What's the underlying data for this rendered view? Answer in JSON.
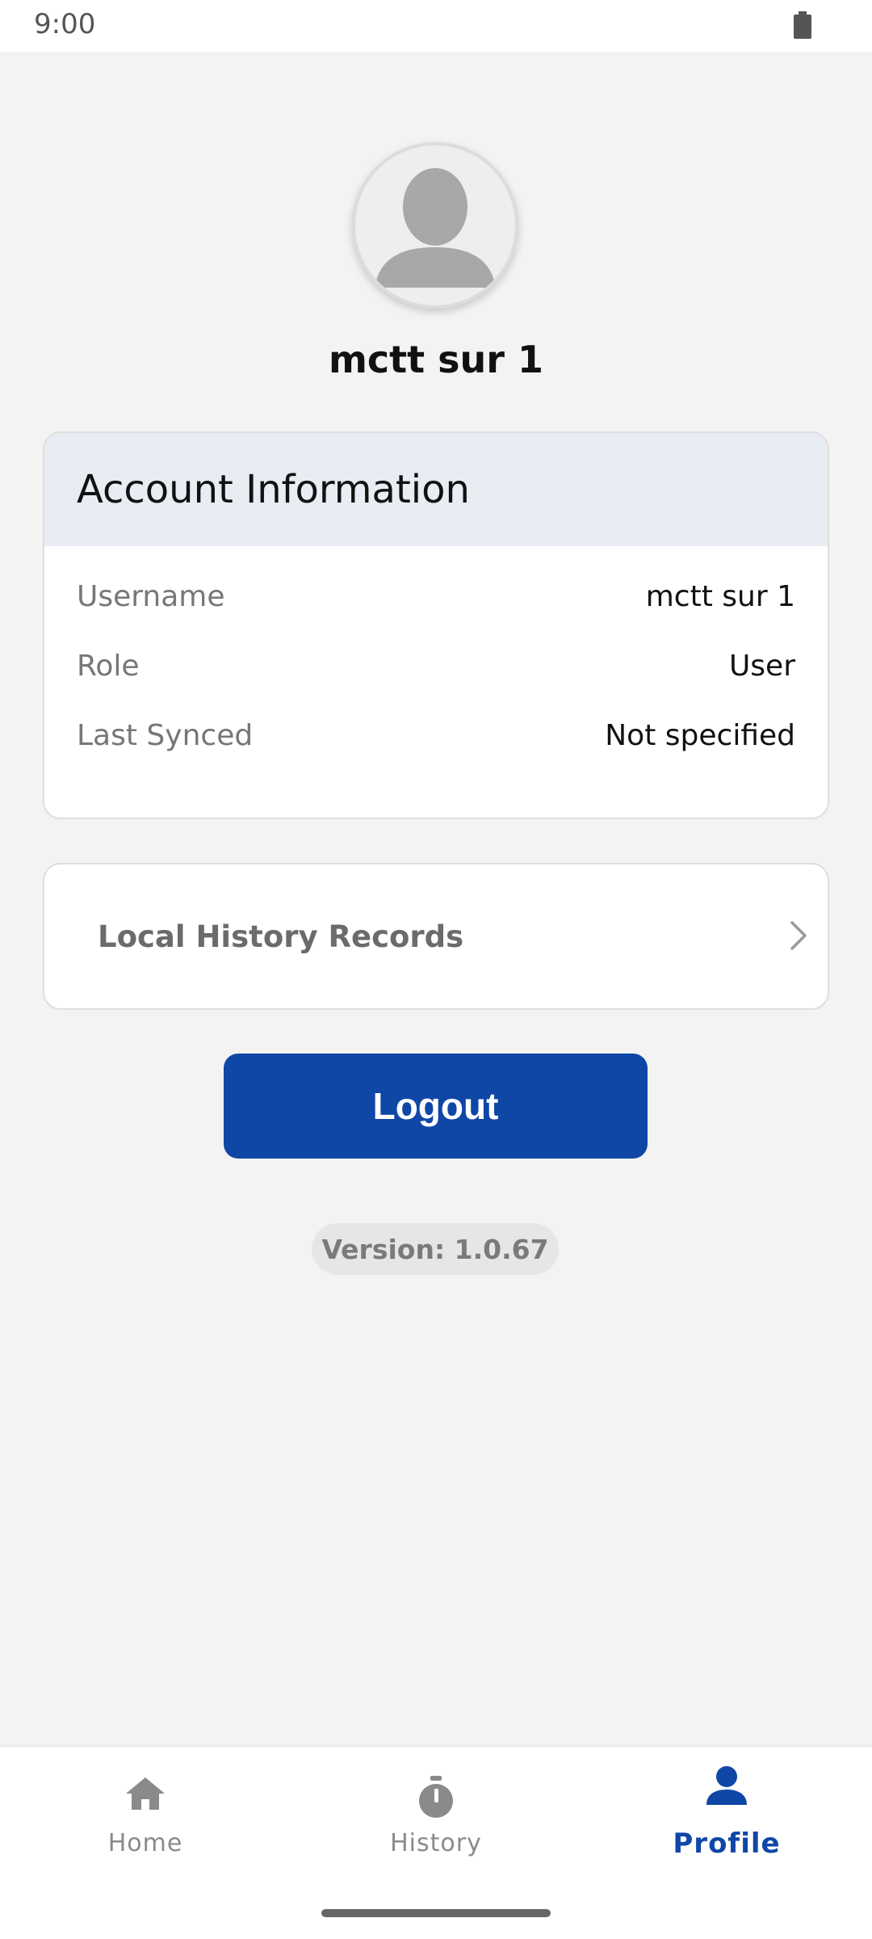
{
  "status_bar": {
    "time": "9:00",
    "battery_icon": "battery-icon"
  },
  "profile": {
    "avatar_icon": "person-avatar-icon",
    "name": "mctt sur 1"
  },
  "account_info": {
    "title": "Account Information",
    "rows": [
      {
        "label": "Username",
        "value": "mctt sur 1"
      },
      {
        "label": "Role",
        "value": "User"
      },
      {
        "label": "Last Synced",
        "value": "Not specified"
      }
    ]
  },
  "history_link": {
    "label": "Local History Records",
    "icon": "chevron-right-icon"
  },
  "logout": {
    "label": "Logout"
  },
  "version": {
    "text": "Version: 1.0.67"
  },
  "bottom_nav": {
    "items": [
      {
        "label": "Home",
        "icon": "home-icon",
        "active": false
      },
      {
        "label": "History",
        "icon": "stopwatch-icon",
        "active": false
      },
      {
        "label": "Profile",
        "icon": "person-icon",
        "active": true
      }
    ]
  },
  "colors": {
    "accent": "#0f47a7",
    "background": "#f3f3f3",
    "header_bg": "#e8ecf3",
    "inactive": "#8a8a8a"
  }
}
